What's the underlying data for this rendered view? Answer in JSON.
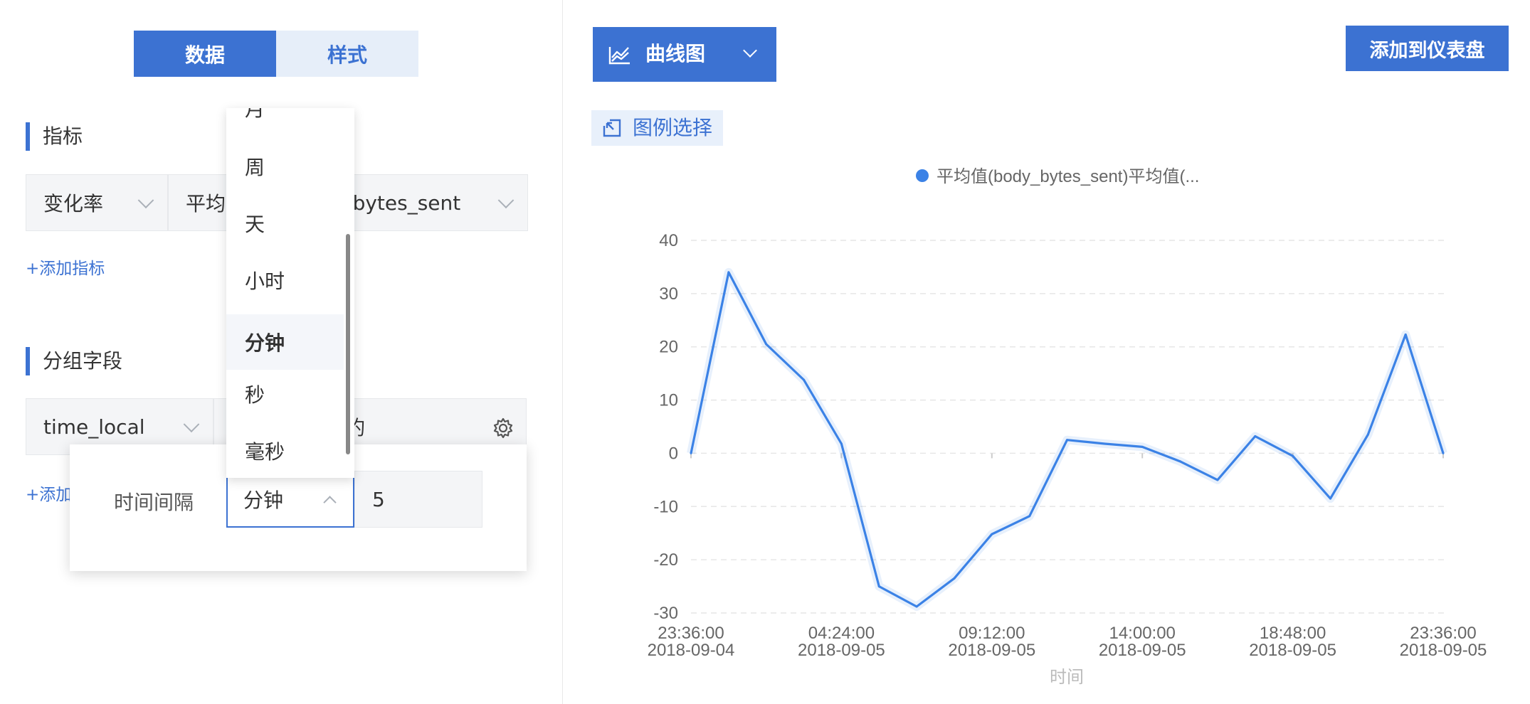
{
  "tabs": {
    "data_label": "数据",
    "style_label": "样式"
  },
  "metrics": {
    "section_title": "指标",
    "function_value": "变化率",
    "aggregate_value_prefix": "平均",
    "field_value": "y_bytes_sent",
    "add_label": "+添加指标"
  },
  "group": {
    "section_title": "分组字段",
    "field_value": "time_local",
    "second_value_suffix": "钓",
    "add_label": "+添加"
  },
  "time_unit_dropdown": {
    "options": [
      "月",
      "周",
      "天",
      "小时",
      "分钟",
      "秒",
      "毫秒"
    ],
    "selected": "分钟"
  },
  "interval_popup": {
    "label": "时间间隔",
    "unit_value": "分钟",
    "number_value": "5"
  },
  "toolbar": {
    "chart_type_label": "曲线图",
    "add_to_dashboard_label": "添加到仪表盘",
    "legend_select_label": "图例选择"
  },
  "chart_data": {
    "type": "line",
    "legend": [
      "平均值(body_bytes_sent)平均值(..."
    ],
    "series": [
      {
        "name": "平均值(body_bytes_sent)平均值(...",
        "color": "#3b82e6",
        "values": [
          0,
          34,
          20.5,
          13.8,
          1.8,
          -25,
          -28.8,
          -23.5,
          -15.2,
          -11.8,
          2.5,
          1.8,
          1.2,
          -1.5,
          -5,
          3.2,
          -0.5,
          -8.5,
          3.5,
          22.3,
          0
        ]
      }
    ],
    "x_labels": [
      [
        "23:36:00",
        "2018-09-04"
      ],
      [
        "04:24:00",
        "2018-09-05"
      ],
      [
        "09:12:00",
        "2018-09-05"
      ],
      [
        "14:00:00",
        "2018-09-05"
      ],
      [
        "18:48:00",
        "2018-09-05"
      ],
      [
        "23:36:00",
        "2018-09-05"
      ]
    ],
    "y_ticks": [
      40,
      30,
      20,
      10,
      0,
      -10,
      -20,
      -30
    ],
    "ylim": [
      -30,
      40
    ],
    "xlabel": "时间",
    "ylabel": "",
    "grid": true,
    "legend_position": "top-center"
  }
}
